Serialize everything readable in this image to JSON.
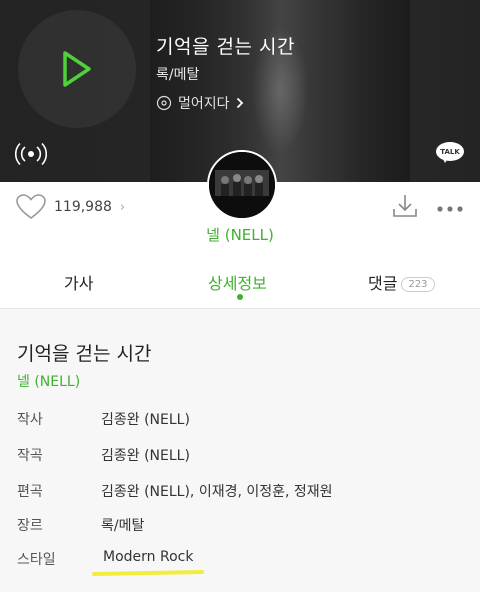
{
  "song": {
    "title": "기억을 걷는 시간",
    "genre": "록/메탈",
    "related_label": "멀어지다"
  },
  "icons": {
    "play": "play-icon",
    "radio": "broadcast-icon",
    "talk": "kakaotalk-icon",
    "like": "heart-icon",
    "download": "download-icon",
    "more": "more-dots-icon"
  },
  "talk_label": "TALK",
  "like_count": "119,988",
  "artist": "넬 (NELL)",
  "tabs": [
    {
      "label": "가사",
      "active": false
    },
    {
      "label": "상세정보",
      "active": true
    },
    {
      "label": "댓글",
      "badge": "223",
      "active": false
    }
  ],
  "details": {
    "title": "기억을 걷는 시간",
    "artist": "넬 (NELL)",
    "rows": [
      {
        "label": "작사",
        "value": "김종완 (NELL)"
      },
      {
        "label": "작곡",
        "value": "김종완 (NELL)"
      },
      {
        "label": "편곡",
        "value": "김종완 (NELL), 이재경, 이정훈, 정재원"
      },
      {
        "label": "장르",
        "value": "록/메탈"
      },
      {
        "label": "스타일",
        "value": "Modern Rock"
      }
    ]
  },
  "colors": {
    "accent": "#3fb12f",
    "hero_bg": "#2a2a2a",
    "highlight": "#f3ec3d"
  }
}
